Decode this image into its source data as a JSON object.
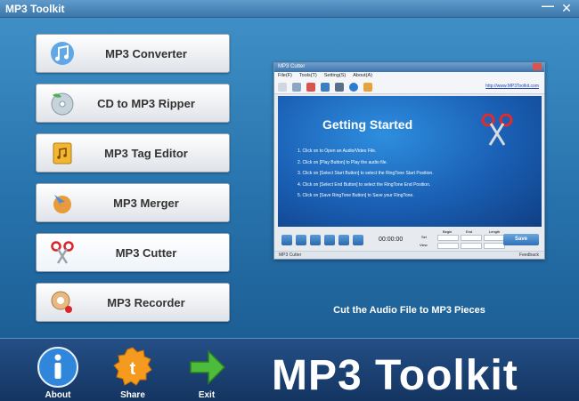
{
  "window": {
    "title": "MP3 Toolkit",
    "min_glyph": "—",
    "close_glyph": "✕"
  },
  "menu": [
    {
      "label": "MP3 Converter",
      "icon": "music-note-icon"
    },
    {
      "label": "CD to MP3 Ripper",
      "icon": "cd-disc-icon"
    },
    {
      "label": "MP3 Tag Editor",
      "icon": "tag-music-icon"
    },
    {
      "label": "MP3 Merger",
      "icon": "merge-arrow-icon"
    },
    {
      "label": "MP3 Cutter",
      "icon": "scissors-icon",
      "selected": true
    },
    {
      "label": "MP3 Recorder",
      "icon": "record-microphone-icon"
    }
  ],
  "preview": {
    "title": "MP3 Cutter",
    "menu": [
      "File(F)",
      "Tools(T)",
      "Setting(S)",
      "About(A)"
    ],
    "url": "http://www.MP3Toolkit.com",
    "heading": "Getting Started",
    "steps": [
      "1. Click on        to Open an Audio/Video File.",
      "2. Click on        [Play Button] to Play the audio file.",
      "3. Click on        [Select Start Button] to select the RingTone Start Position.",
      "4. Click on        [Select End Button] to select the RingTone End Position.",
      "5. Click on        [Save RingTone Button] to Save your RingTone."
    ],
    "time": "00:00:00",
    "grid_headers": [
      "Begin",
      "End",
      "Length"
    ],
    "grid_rows": [
      "Sel",
      "View"
    ],
    "save_label": "Save",
    "status": "MP3 Cutter",
    "feedback": "Feedback"
  },
  "caption": "Cut the Audio File to MP3 Pieces",
  "footer": {
    "about": "About",
    "share": "Share",
    "exit": "Exit",
    "brand": "MP3 Toolkit"
  },
  "colors": {
    "accent": "#2873ad",
    "footer": "#1a3f70",
    "button_text": "#333333"
  }
}
